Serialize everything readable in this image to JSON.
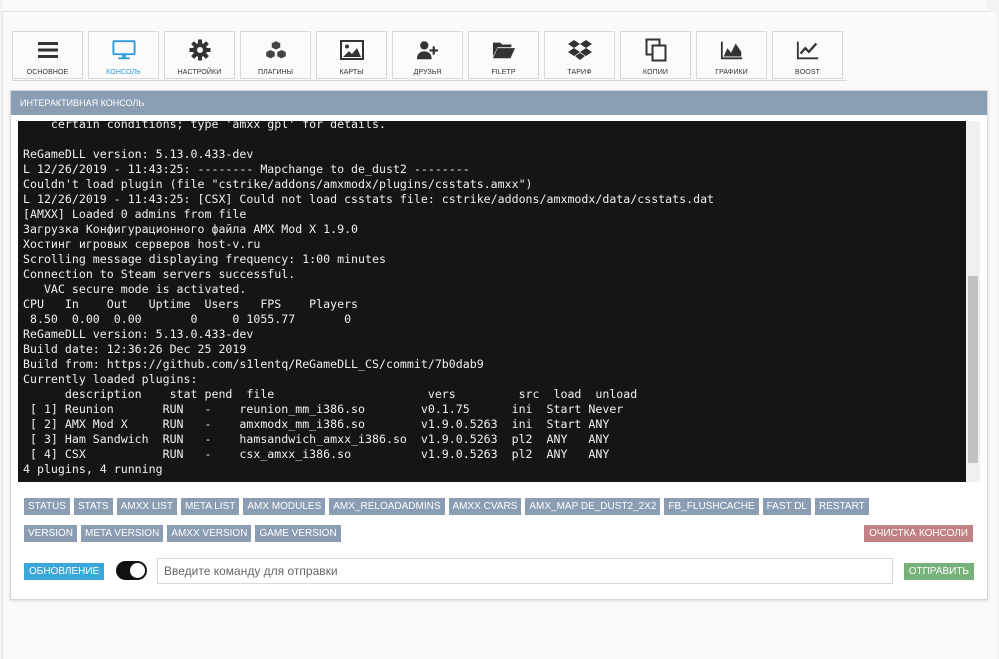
{
  "colors": {
    "panel_header": "#8a9db3",
    "command_button": "#8a9db3",
    "clear_button": "#c28184",
    "refresh_button": "#3ba6d8",
    "send_button": "#77b27a",
    "active_tab": "#2a9bd8",
    "console_bg": "#151515"
  },
  "toolbar": {
    "items": [
      {
        "label": "ОСНОВНОЕ",
        "icon": "menu-icon",
        "active": false
      },
      {
        "label": "КОНСОЛЬ",
        "icon": "monitor-icon",
        "active": true
      },
      {
        "label": "НАСТРОЙКИ",
        "icon": "gear-icon",
        "active": false
      },
      {
        "label": "ПЛАГИНЫ",
        "icon": "cubes-icon",
        "active": false
      },
      {
        "label": "КАРТЫ",
        "icon": "image-icon",
        "active": false
      },
      {
        "label": "ДРУЗЬЯ",
        "icon": "user-plus-icon",
        "active": false
      },
      {
        "label": "FILETP",
        "icon": "folder-open-icon",
        "active": false
      },
      {
        "label": "ТАРИФ",
        "icon": "dropbox-icon",
        "active": false
      },
      {
        "label": "КОПИИ",
        "icon": "copy-icon",
        "active": false
      },
      {
        "label": "ГРАФИКИ",
        "icon": "area-chart-icon",
        "active": false
      },
      {
        "label": "BOOST",
        "icon": "line-chart-icon",
        "active": false
      }
    ]
  },
  "panel": {
    "title": "ИНТЕРАКТИВНАЯ КОНСОЛЬ"
  },
  "console": {
    "lines": [
      "    certain conditions; type 'amxx gpl' for details.",
      "",
      "ReGameDLL version: 5.13.0.433-dev",
      "L 12/26/2019 - 11:43:25: -------- Mapchange to de_dust2 --------",
      "Couldn't load plugin (file \"cstrike/addons/amxmodx/plugins/csstats.amxx\")",
      "L 12/26/2019 - 11:43:25: [CSX] Could not load csstats file: cstrike/addons/amxmodx/data/csstats.dat",
      "[AMXX] Loaded 0 admins from file",
      "Загрузка Конфигурационного файла AMX Mod X 1.9.0",
      "Хостинг игровых серверов host-v.ru",
      "Scrolling message displaying frequency: 1:00 minutes",
      "Connection to Steam servers successful.",
      "   VAC secure mode is activated.",
      "CPU   In    Out   Uptime  Users   FPS    Players",
      " 8.50  0.00  0.00       0     0 1055.77       0",
      "ReGameDLL version: 5.13.0.433-dev",
      "Build date: 12:36:26 Dec 25 2019",
      "Build from: https://github.com/s1lentq/ReGameDLL_CS/commit/7b0dab9",
      "Currently loaded plugins:",
      "      description    stat pend  file                      vers         src  load  unload",
      " [ 1] Reunion       RUN   -    reunion_mm_i386.so        v0.1.75      ini  Start Never",
      " [ 2] AMX Mod X     RUN   -    amxmodx_mm_i386.so        v1.9.0.5263  ini  Start ANY",
      " [ 3] Ham Sandwich  RUN   -    hamsandwich_amxx_i386.so  v1.9.0.5263  pl2  ANY   ANY",
      " [ 4] CSX           RUN   -    csx_amxx_i386.so          v1.9.0.5263  pl2  ANY   ANY",
      "4 plugins, 4 running"
    ]
  },
  "commands": {
    "row1": [
      "STATUS",
      "STATS",
      "AMXX LIST",
      "META LIST",
      "AMX MODULES",
      "AMX_RELOADADMINS",
      "AMXX CVARS",
      "AMX_MAP DE_DUST2_2X2",
      "FB_FLUSHCACHE",
      "FAST DL",
      "RESTART"
    ],
    "row2": [
      "VERSION",
      "META VERSION",
      "AMXX VERSION",
      "GAME VERSION"
    ],
    "clear_label": "ОЧИСТКА КОНСОЛИ"
  },
  "input_bar": {
    "refresh_label": "ОБНОВЛЕНИЕ",
    "auto_refresh_on": true,
    "placeholder": "Введите команду для отправки",
    "value": "",
    "send_label": "ОТПРАВИТЬ"
  }
}
